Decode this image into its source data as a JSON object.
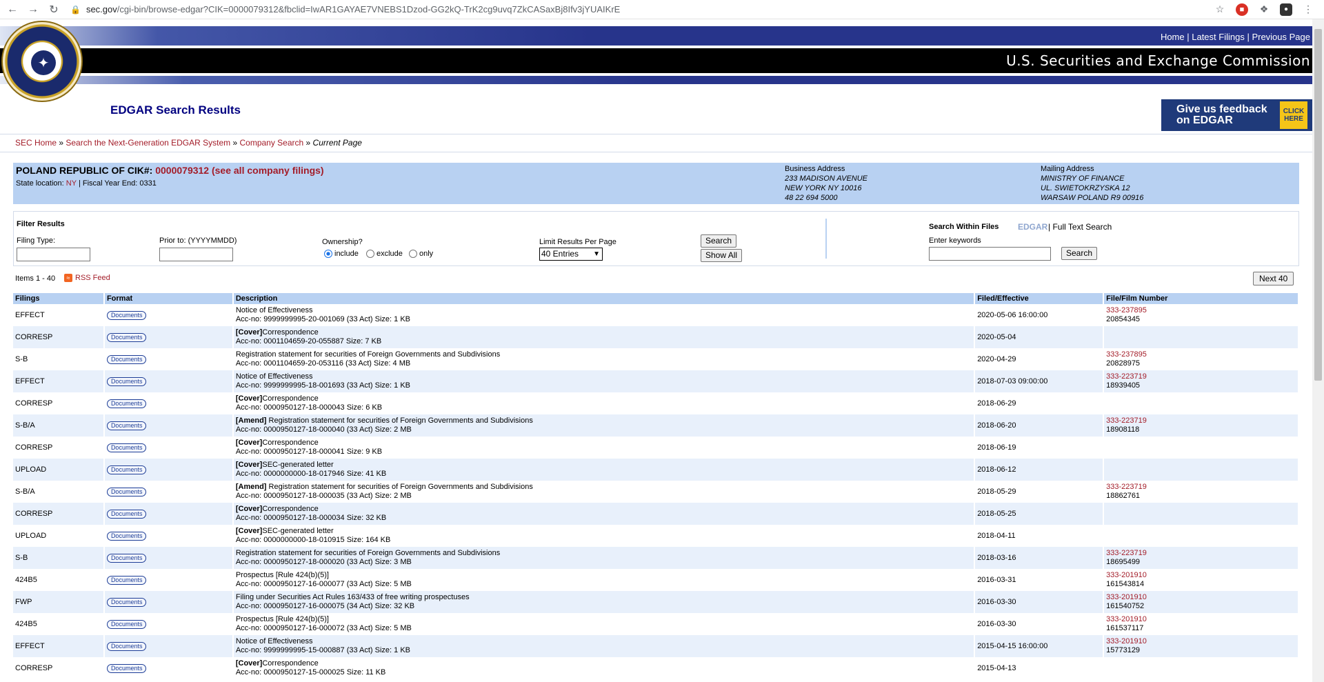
{
  "browser": {
    "url_host": "sec.gov",
    "url_rest": "/cgi-bin/browse-edgar?CIK=0000079312&fbclid=IwAR1GAYAE7VNEBS1Dzod-GG2kQ-TrK2cg9uvq7ZkCASaxBj8Ifv3jYUAIKrE"
  },
  "header": {
    "links": [
      "Home",
      "Latest Filings",
      "Previous Page"
    ],
    "agency": "U.S. Securities and Exchange Commission",
    "page_title": "EDGAR Search Results",
    "feedback_text": "Give us feedback on EDGAR",
    "feedback_click": "CLICK HERE"
  },
  "breadcrumb": {
    "items": [
      "SEC Home",
      "Search the Next-Generation EDGAR System",
      "Company Search"
    ],
    "current": "Current Page"
  },
  "company": {
    "name": "POLAND REPUBLIC OF",
    "cik_label": "CIK#:",
    "cik": "0000079312 (see all company filings)",
    "state_label": "State location:",
    "state": "NY",
    "fiscal": "| Fiscal Year End: 0331",
    "business_title": "Business Address",
    "business_lines": [
      "233 MADISON AVENUE",
      "NEW YORK NY 10016",
      "48 22 694 5000"
    ],
    "mailing_title": "Mailing Address",
    "mailing_lines": [
      "MINISTRY OF FINANCE",
      "UL. SWIETOKRZYSKA 12",
      "WARSAW POLAND R9 00916"
    ]
  },
  "filter": {
    "title": "Filter Results",
    "filing_type_label": "Filing Type:",
    "prior_to_label": "Prior to: (YYYYMMDD)",
    "ownership_label": "Ownership?",
    "ownership_options": [
      "include",
      "exclude",
      "only"
    ],
    "limit_label": "Limit Results Per Page",
    "limit_value": "40 Entries",
    "search_button": "Search",
    "show_all_button": "Show All",
    "sw_title": "Search Within Files",
    "sw_edgar": "EDGAR",
    "sw_fts": "| Full Text Search",
    "keywords_label": "Enter keywords",
    "keywords_button": "Search"
  },
  "results": {
    "items_text": "Items 1 - 40",
    "rss_text": "RSS Feed",
    "next_button": "Next 40",
    "headers": [
      "Filings",
      "Format",
      "Description",
      "Filed/Effective",
      "File/Film Number"
    ],
    "doc_label": "Documents",
    "rows": [
      {
        "filing": "EFFECT",
        "tag": "",
        "title": "Notice of Effectiveness",
        "acc": "Acc-no: 9999999995-20-001069 (33 Act)  Size: 1 KB",
        "filed": "2020-05-06 16:00:00",
        "file_no": "333-237895",
        "film_no": "20854345"
      },
      {
        "filing": "CORRESP",
        "tag": "[Cover]",
        "title": "Correspondence",
        "acc": "Acc-no: 0001104659-20-055887 Size: 7 KB",
        "filed": "2020-05-04",
        "file_no": "",
        "film_no": ""
      },
      {
        "filing": "S-B",
        "tag": "",
        "title": "Registration statement for securities of Foreign Governments and Subdivisions",
        "acc": "Acc-no: 0001104659-20-053116 (33 Act)  Size: 4 MB",
        "filed": "2020-04-29",
        "file_no": "333-237895",
        "film_no": "20828975"
      },
      {
        "filing": "EFFECT",
        "tag": "",
        "title": "Notice of Effectiveness",
        "acc": "Acc-no: 9999999995-18-001693 (33 Act)  Size: 1 KB",
        "filed": "2018-07-03 09:00:00",
        "file_no": "333-223719",
        "film_no": "18939405"
      },
      {
        "filing": "CORRESP",
        "tag": "[Cover]",
        "title": "Correspondence",
        "acc": "Acc-no: 0000950127-18-000043 Size: 6 KB",
        "filed": "2018-06-29",
        "file_no": "",
        "film_no": ""
      },
      {
        "filing": "S-B/A",
        "tag": "[Amend]",
        "title": " Registration statement for securities of Foreign Governments and Subdivisions",
        "acc": "Acc-no: 0000950127-18-000040 (33 Act)  Size: 2 MB",
        "filed": "2018-06-20",
        "file_no": "333-223719",
        "film_no": "18908118"
      },
      {
        "filing": "CORRESP",
        "tag": "[Cover]",
        "title": "Correspondence",
        "acc": "Acc-no: 0000950127-18-000041 Size: 9 KB",
        "filed": "2018-06-19",
        "file_no": "",
        "film_no": ""
      },
      {
        "filing": "UPLOAD",
        "tag": "[Cover]",
        "title": "SEC-generated letter",
        "acc": "Acc-no: 0000000000-18-017946 Size: 41 KB",
        "filed": "2018-06-12",
        "file_no": "",
        "film_no": ""
      },
      {
        "filing": "S-B/A",
        "tag": "[Amend]",
        "title": " Registration statement for securities of Foreign Governments and Subdivisions",
        "acc": "Acc-no: 0000950127-18-000035 (33 Act)  Size: 2 MB",
        "filed": "2018-05-29",
        "file_no": "333-223719",
        "film_no": "18862761"
      },
      {
        "filing": "CORRESP",
        "tag": "[Cover]",
        "title": "Correspondence",
        "acc": "Acc-no: 0000950127-18-000034 Size: 32 KB",
        "filed": "2018-05-25",
        "file_no": "",
        "film_no": ""
      },
      {
        "filing": "UPLOAD",
        "tag": "[Cover]",
        "title": "SEC-generated letter",
        "acc": "Acc-no: 0000000000-18-010915 Size: 164 KB",
        "filed": "2018-04-11",
        "file_no": "",
        "film_no": ""
      },
      {
        "filing": "S-B",
        "tag": "",
        "title": "Registration statement for securities of Foreign Governments and Subdivisions",
        "acc": "Acc-no: 0000950127-18-000020 (33 Act)  Size: 3 MB",
        "filed": "2018-03-16",
        "file_no": "333-223719",
        "film_no": "18695499"
      },
      {
        "filing": "424B5",
        "tag": "",
        "title": "Prospectus [Rule 424(b)(5)]",
        "acc": "Acc-no: 0000950127-16-000077 (33 Act)  Size: 5 MB",
        "filed": "2016-03-31",
        "file_no": "333-201910",
        "film_no": "161543814"
      },
      {
        "filing": "FWP",
        "tag": "",
        "title": "Filing under Securities Act Rules 163/433 of free writing prospectuses",
        "acc": "Acc-no: 0000950127-16-000075 (34 Act)  Size: 32 KB",
        "filed": "2016-03-30",
        "file_no": "333-201910",
        "film_no": "161540752"
      },
      {
        "filing": "424B5",
        "tag": "",
        "title": "Prospectus [Rule 424(b)(5)]",
        "acc": "Acc-no: 0000950127-16-000072 (33 Act)  Size: 5 MB",
        "filed": "2016-03-30",
        "file_no": "333-201910",
        "film_no": "161537117"
      },
      {
        "filing": "EFFECT",
        "tag": "",
        "title": "Notice of Effectiveness",
        "acc": "Acc-no: 9999999995-15-000887 (33 Act)  Size: 1 KB",
        "filed": "2015-04-15 16:00:00",
        "file_no": "333-201910",
        "film_no": "15773129"
      },
      {
        "filing": "CORRESP",
        "tag": "[Cover]",
        "title": "Correspondence",
        "acc": "Acc-no: 0000950127-15-000025 Size: 11 KB",
        "filed": "2015-04-13",
        "file_no": "",
        "film_no": ""
      }
    ]
  }
}
